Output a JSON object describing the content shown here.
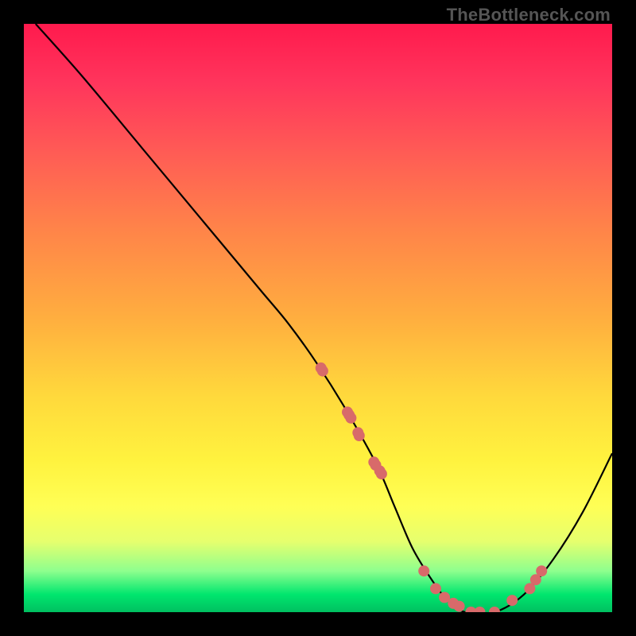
{
  "watermark": "TheBottleneck.com",
  "chart_data": {
    "type": "line",
    "title": "",
    "xlabel": "",
    "ylabel": "",
    "xlim": [
      0,
      100
    ],
    "ylim": [
      0,
      100
    ],
    "series": [
      {
        "name": "curve",
        "x": [
          2,
          10,
          20,
          30,
          40,
          45,
          50,
          55,
          60,
          63,
          66,
          69,
          72,
          75,
          80,
          85,
          90,
          95,
          100
        ],
        "y": [
          100,
          91,
          79,
          67,
          55,
          49,
          42,
          34,
          25,
          18,
          11,
          6,
          2,
          0,
          0,
          3,
          9,
          17,
          27
        ]
      }
    ],
    "scatter": {
      "name": "points",
      "color": "#d86a6a",
      "x": [
        50.5,
        50.8,
        55.0,
        55.3,
        55.6,
        56.8,
        57.0,
        59.5,
        59.8,
        60.5,
        60.8,
        68.0,
        70.0,
        71.5,
        73.0,
        74.0,
        76.0,
        77.5,
        80.0,
        83.0,
        86.0,
        87.0,
        88.0
      ],
      "y": [
        41.5,
        41.0,
        34.0,
        33.5,
        33.0,
        30.5,
        30.0,
        25.5,
        25.0,
        24.0,
        23.5,
        7.0,
        4.0,
        2.5,
        1.5,
        1.0,
        0.0,
        0.0,
        0.0,
        2.0,
        4.0,
        5.5,
        7.0
      ]
    }
  }
}
